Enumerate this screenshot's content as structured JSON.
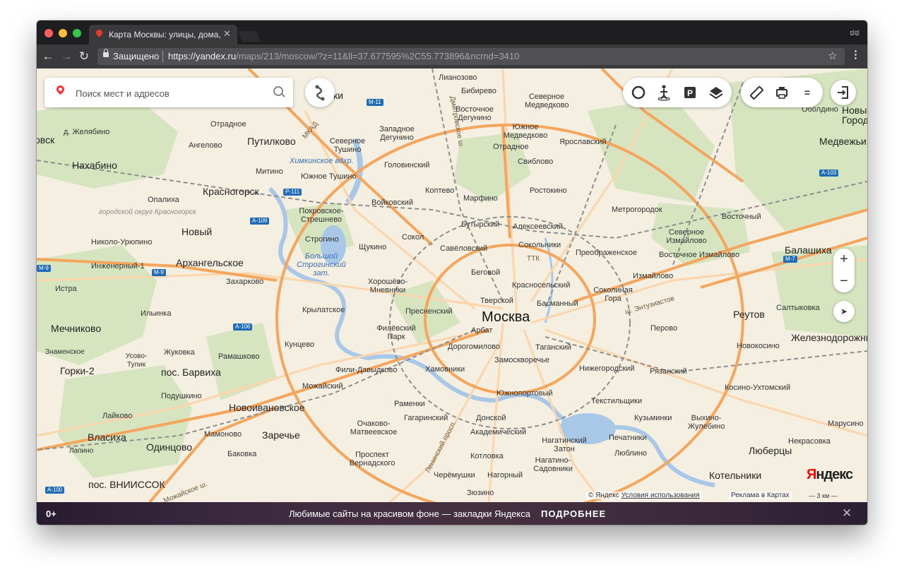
{
  "browser": {
    "tab_title": "Карта Москвы: улицы, дома, организации",
    "tab_close": "✕",
    "secure_label": "Защищено",
    "url_host": "https://yandex.ru",
    "url_path": "/maps/213/moscow/?z=11&ll=37.677595%2C55.773896&ncrnd=3410",
    "back": "←",
    "forward": "→",
    "reload": "↻",
    "bookmark": "☆",
    "menu": "⋮",
    "incognito": "ಠಠ"
  },
  "search": {
    "placeholder": "Поиск мест и адресов"
  },
  "controls": {
    "zoom_in": "+",
    "zoom_out": "−",
    "geo": "➤",
    "ruler": "📏",
    "print": "🖨",
    "menu": "="
  },
  "map_labels": {
    "moscow": "Москва",
    "krasnogorsk": "Красногорск",
    "odintsovo": "Одинцово",
    "balashikha": "Балашиха",
    "reutov": "Реутов",
    "lyubertsy": "Люберцы",
    "kotelniki": "Котельники",
    "zheleznodorozhny": "Железнодорожный",
    "medvezhi": "Медвежьи",
    "nakhabino": "Нахабино",
    "putilkovo": "Путилково",
    "mechnikovo": "Мечниково",
    "gorki2": "Горки-2",
    "vlasikha": "Власиха",
    "arkhangelskoe": "Архангельское",
    "novy": "Новый",
    "pos_barvikha": "пос. Барвиха",
    "novoivanovskoe": "Новоивановское",
    "zarechye": "Заречье",
    "pos_vniissok": "пос. ВНИИССОК",
    "novy_gorod": "Новый Город",
    "lianozovo": "Лианозово",
    "bibirevo": "Бибирево",
    "severnoe_medvedkovo": "Северное Медведково",
    "vostochnoe_degunino": "Восточное Дегунино",
    "yuzhnoe_medvedkovo": "Южное Медведково",
    "yaroslavsky": "Ярославский",
    "otradnoe": "Отрадное",
    "sviblovo": "Свиблово",
    "zapadnoe_degunino": "Западное Дегунино",
    "severnoe_tushino": "Северное Тушино",
    "golovinsky": "Головинский",
    "yuzhnoe_tushino": "Южное Тушино",
    "mitino": "Митино",
    "khimki_reservoir": "Химкинское вдхр.",
    "koptevo": "Коптево",
    "marfino": "Марфино",
    "rostokino": "Ростокино",
    "voykovsky": "Войковский",
    "metrogorodok": "Метрогородок",
    "vostochny": "Восточный",
    "pokrovskoe_streshnevo": "Покровское-Стрешнево",
    "butyrsky": "Бутырский",
    "alekseevsky": "Алексеевский",
    "severnoe_izmailovo": "Северное Измайлово",
    "strogino": "Строгино",
    "sokol": "Сокол",
    "savelovsky": "Савёловский",
    "sokolniki": "Сокольники",
    "preobrazhenskoe": "Преображенское",
    "vostochnoe_izmailovo": "Восточное Измайлово",
    "shchukino": "Щукино",
    "bolshoy_zaton": "Большой Строгинский зат.",
    "begovoy": "Беговой",
    "izmailovo": "Измайлово",
    "khoroshevo": "Хорошёво-Мневники",
    "krasnoselsky": "Красносельский",
    "sokolinaya_gora": "Соколиная Гора",
    "tverskoy": "Тверской",
    "basmanny": "Басманный",
    "krylatskoe": "Крылатское",
    "presnensky": "Пресненский",
    "saltykovka": "Салтыковка",
    "filevsky_park": "Филёвский Парк",
    "arbat": "Арбат",
    "perovo": "Перово",
    "kuntsevo": "Кунцево",
    "dorogomilovo": "Дорогомилово",
    "tagansky": "Таганский",
    "novokosino": "Новокосино",
    "zamoskvorechye": "Замоскворечье",
    "fili_davydkovo": "Фили-Давыдково",
    "khamovniki": "Хамовники",
    "nizhegorodsky": "Нижегородский",
    "ryazansky": "Рязанский",
    "kosino_ukhtomsky": "Косино-Ухтомский",
    "mozhaysky": "Можайский",
    "yuzhnoportovy": "Южнопортовый",
    "ramenki": "Раменки",
    "tekstilshchiki": "Текстильщики",
    "gagarinsky": "Гагаринский",
    "donskoy": "Донской",
    "kuzminki": "Кузьминки",
    "vykhino": "Выхино-Жулебино",
    "ochakovo": "Очаково-Матвеевское",
    "akademichesky": "Академический",
    "pechatniki": "Печатники",
    "nagatinsky": "Нагатинский Затон",
    "prospekt_vernadskogo": "Проспект Вернадского",
    "kotlovka": "Котловка",
    "lyublino": "Люблино",
    "nagatino_sadovniki": "Нагатино-Садовники",
    "cheremushki": "Черёмушки",
    "nagorny": "Нагорный",
    "zyuzino": "Зюзино",
    "nekrasovka": "Некрасовка",
    "marusino": "Марусино",
    "oboldino": "Оболдино",
    "zhelyabino": "д. Желябино",
    "angelovo": "Ангелово",
    "otradnoe_w": "Отрадное",
    "opalikha": "Опалиха",
    "krasnogorsk_district": "городской округ Красногорск",
    "nikolo_uryupino": "Николо-Урюпино",
    "inzhenerny": "Инженерный-1",
    "zakharkovo": "Захарково",
    "istra": "Истра",
    "ilyinka": "Ильинка",
    "znamenskoe": "Знаменское",
    "zhukovka": "Жуковка",
    "romashkovo": "Рамашково",
    "usovo_tupik": "Усово-Тупик",
    "podushkino": "Подушкино",
    "laykovo": "Лайково",
    "mamonovo": "Мамоново",
    "lapino": "Лапино",
    "bakovka": "Баковка",
    "vorovsk_partial": "овск",
    "khimki_partial": "ки",
    "balashikha_ttk": "ТТК",
    "mkad": "МКАД",
    "ttk": "ТТК",
    "sh_entuziastov": "ш. Энтузиастов",
    "leninsky": "Ленинский просп.",
    "dmitrovskoe": "Дмитровское ш.",
    "mozhayskoe": "Можайское ш.",
    "lyubertsy_small": "Люберц"
  },
  "road_shields": {
    "m11": "М-11",
    "p111": "Р-111",
    "a109": "А-109",
    "m9": "М-9",
    "m9b": "М-9",
    "a106": "А-106",
    "a100": "А-100",
    "a103": "А-103",
    "m7": "М-7"
  },
  "attribution": {
    "copyright": "© Яндекс",
    "terms": "Условия использования",
    "ads": "Реклама в Картах",
    "scale": "3 км",
    "logo_ya": "Я",
    "logo_rest": "ндекс"
  },
  "banner": {
    "age": "0+",
    "text": "Любимые сайты на красивом фоне — закладки Яндекса",
    "more": "ПОДРОБНЕЕ",
    "close": "✕"
  },
  "colors": {
    "primary_road": "#f5a55c",
    "secondary_road": "#fbd3a6",
    "water": "#a8c7e8",
    "park": "#cfe0b8",
    "railway": "#8a8a8a"
  }
}
